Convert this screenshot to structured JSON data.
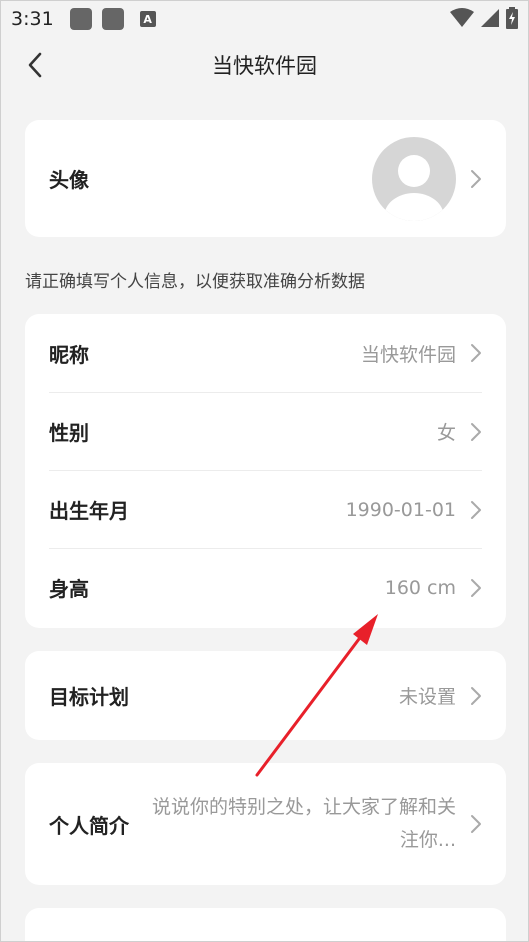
{
  "status_bar": {
    "time": "3:31"
  },
  "header": {
    "title": "当快软件园"
  },
  "avatar_row": {
    "label": "头像"
  },
  "hint": "请正确填写个人信息，以便获取准确分析数据",
  "info": {
    "nickname": {
      "label": "昵称",
      "value": "当快软件园"
    },
    "gender": {
      "label": "性别",
      "value": "女"
    },
    "birth": {
      "label": "出生年月",
      "value": "1990-01-01"
    },
    "height": {
      "label": "身高",
      "value": "160 cm"
    }
  },
  "goal": {
    "label": "目标计划",
    "value": "未设置"
  },
  "bio": {
    "label": "个人简介",
    "placeholder": "说说你的特别之处，让大家了解和关注你..."
  },
  "colors": {
    "background": "#f3f3f3",
    "card": "#ffffff",
    "muted": "#999999",
    "arrow": "#e8202a"
  }
}
